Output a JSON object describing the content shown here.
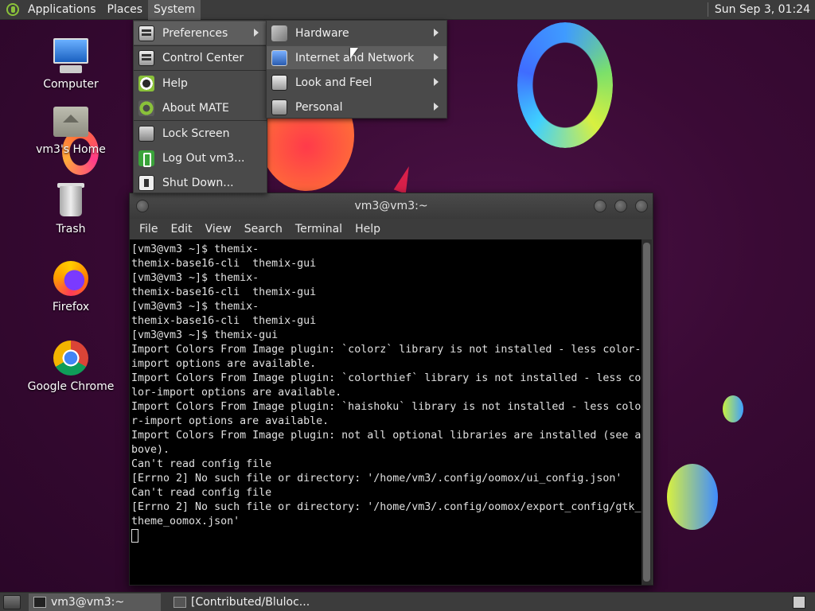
{
  "top_panel": {
    "menus": [
      "Applications",
      "Places",
      "System"
    ],
    "clock": "Sun Sep  3, 01:24"
  },
  "desktop_icons": [
    {
      "label": "Computer",
      "icon": "computer-icon"
    },
    {
      "label": "vm3's Home",
      "icon": "home-folder-icon"
    },
    {
      "label": "Trash",
      "icon": "trash-icon"
    },
    {
      "label": "Firefox",
      "icon": "firefox-icon"
    },
    {
      "label": "Google Chrome",
      "icon": "chrome-icon"
    }
  ],
  "system_menu": {
    "items": [
      {
        "label": "Preferences",
        "icon": "preferences-icon"
      },
      {
        "label": "Control Center",
        "icon": "control-center-icon"
      },
      {
        "label": "Help",
        "icon": "help-icon"
      },
      {
        "label": "About MATE",
        "icon": "mate-icon"
      },
      {
        "label": "Lock Screen",
        "icon": "lock-icon"
      },
      {
        "label": "Log Out vm3...",
        "icon": "logout-icon"
      },
      {
        "label": "Shut Down...",
        "icon": "shutdown-icon"
      }
    ]
  },
  "preferences_submenu": {
    "items": [
      {
        "label": "Hardware",
        "icon": "hardware-icon"
      },
      {
        "label": "Internet and Network",
        "icon": "network-icon"
      },
      {
        "label": "Look and Feel",
        "icon": "look-and-feel-icon"
      },
      {
        "label": "Personal",
        "icon": "personal-icon"
      }
    ]
  },
  "terminal": {
    "title": "vm3@vm3:~",
    "menus": [
      "File",
      "Edit",
      "View",
      "Search",
      "Terminal",
      "Help"
    ],
    "lines": [
      "[vm3@vm3 ~]$ themix-",
      "themix-base16-cli  themix-gui",
      "[vm3@vm3 ~]$ themix-",
      "themix-base16-cli  themix-gui",
      "[vm3@vm3 ~]$ themix-",
      "themix-base16-cli  themix-gui",
      "[vm3@vm3 ~]$ themix-gui",
      "Import Colors From Image plugin: `colorz` library is not installed - less color-",
      "import options are available.",
      "Import Colors From Image plugin: `colorthief` library is not installed - less co",
      "lor-import options are available.",
      "Import Colors From Image plugin: `haishoku` library is not installed - less colo",
      "r-import options are available.",
      "Import Colors From Image plugin: not all optional libraries are installed (see a",
      "bove).",
      "Can't read config file",
      "[Errno 2] No such file or directory: '/home/vm3/.config/oomox/ui_config.json'",
      "Can't read config file",
      "[Errno 2] No such file or directory: '/home/vm3/.config/oomox/export_config/gtk_",
      "theme_oomox.json'"
    ]
  },
  "bottom_panel": {
    "tasks": [
      "vm3@vm3:~",
      "[Contributed/Bluloc..."
    ]
  }
}
